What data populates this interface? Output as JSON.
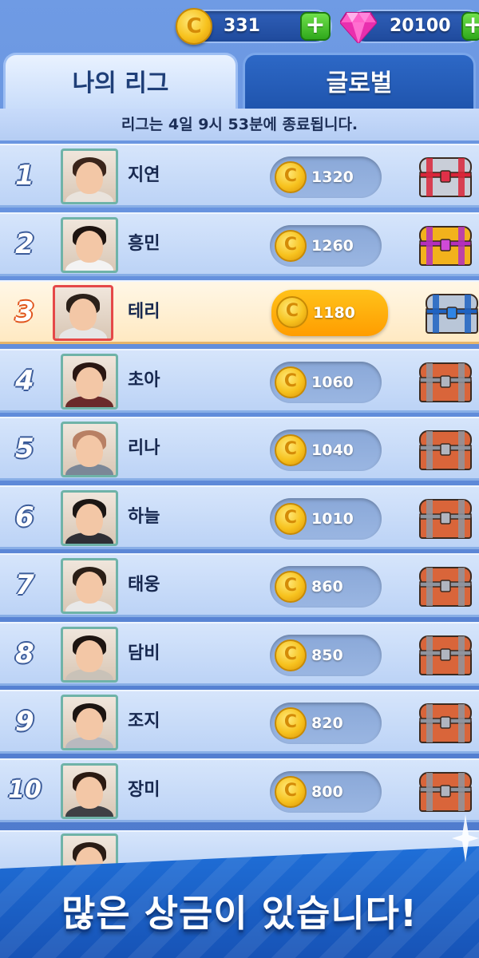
{
  "currency": {
    "coins": "331",
    "gems": "20100",
    "coin_icon": "coin-icon",
    "gem_icon": "gem-icon",
    "add_icon": "plus-icon"
  },
  "tabs": [
    {
      "label": "나의 리그",
      "active": true
    },
    {
      "label": "글로벌",
      "active": false
    }
  ],
  "notice": "리그는 4일 9시 53분에 종료됩니다.",
  "leaderboard": [
    {
      "rank": "1",
      "name": "지연",
      "score": "1320",
      "chest": "red-chest",
      "is_me": false
    },
    {
      "rank": "2",
      "name": "흥민",
      "score": "1260",
      "chest": "gold-chest",
      "is_me": false
    },
    {
      "rank": "3",
      "name": "테리",
      "score": "1180",
      "chest": "blue-chest",
      "is_me": true
    },
    {
      "rank": "4",
      "name": "초아",
      "score": "1060",
      "chest": "wood-chest",
      "is_me": false
    },
    {
      "rank": "5",
      "name": "리나",
      "score": "1040",
      "chest": "wood-chest",
      "is_me": false
    },
    {
      "rank": "6",
      "name": "하늘",
      "score": "1010",
      "chest": "wood-chest",
      "is_me": false
    },
    {
      "rank": "7",
      "name": "태웅",
      "score": "860",
      "chest": "wood-chest",
      "is_me": false
    },
    {
      "rank": "8",
      "name": "담비",
      "score": "850",
      "chest": "wood-chest",
      "is_me": false
    },
    {
      "rank": "9",
      "name": "조지",
      "score": "820",
      "chest": "wood-chest",
      "is_me": false
    },
    {
      "rank": "10",
      "name": "장미",
      "score": "800",
      "chest": "wood-chest",
      "is_me": false
    }
  ],
  "promo": "많은 상금이 있습니다!",
  "colors": {
    "accent": "#1f6fd8",
    "highlight_row": "#ffe9c2",
    "coin": "#f7c21e"
  }
}
